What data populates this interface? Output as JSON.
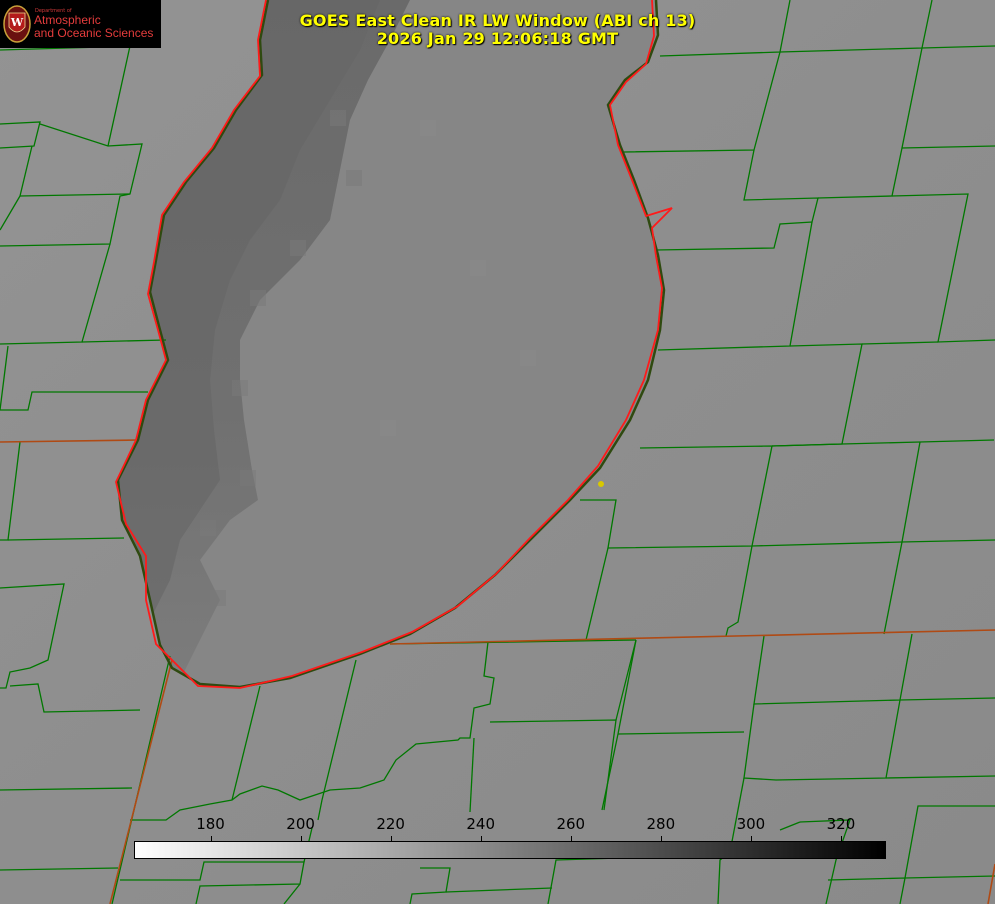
{
  "title": {
    "line1": "GOES East Clean IR LW Window (ABI ch 13)",
    "line2": "2026 Jan 29 12:06:18 GMT"
  },
  "logo": {
    "department": "Department of",
    "line1": "Atmospheric",
    "line2": "and Oceanic Sciences",
    "seal_letter": "W"
  },
  "colorbar": {
    "ticks": [
      "180",
      "200",
      "220",
      "240",
      "260",
      "280",
      "300",
      "320"
    ],
    "min_value": 163,
    "max_value": 330,
    "colors": {
      "low": "#ffffff",
      "high": "#000000"
    }
  },
  "colors": {
    "background": "#8f8f8f",
    "lake_surface": "#858585",
    "lake_dark_band": "#6b6b6b",
    "county_lines": "#007800",
    "shoreline": "#ff0000",
    "title_text": "#ffff00",
    "marker": "#d8c800"
  }
}
